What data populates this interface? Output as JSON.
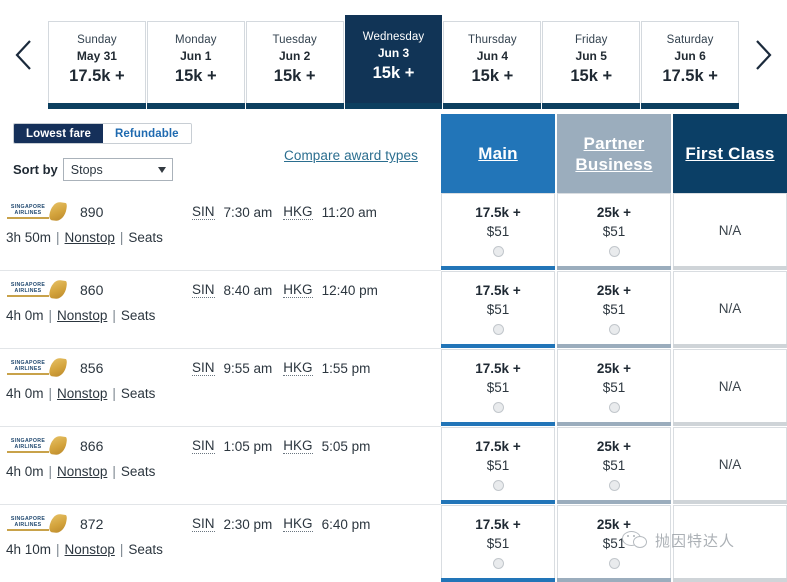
{
  "colors": {
    "selected_day_bg": "#113456",
    "day_underline": "#0d3f5f",
    "main_col": "#2275b8",
    "partner_business_col": "#9badbd",
    "first_class_col": "#0b3f66",
    "na_underline": "#cfd4d8",
    "link": "#2b6e8f"
  },
  "day_selector": {
    "prev_arrow": "chevron-left-icon",
    "next_arrow": "chevron-right-icon",
    "days": [
      {
        "dow": "Sunday",
        "date": "May 31",
        "price": "17.5k +",
        "selected": false
      },
      {
        "dow": "Monday",
        "date": "Jun 1",
        "price": "15k +",
        "selected": false
      },
      {
        "dow": "Tuesday",
        "date": "Jun 2",
        "price": "15k +",
        "selected": false
      },
      {
        "dow": "Wednesday",
        "date": "Jun 3",
        "price": "15k +",
        "selected": true
      },
      {
        "dow": "Thursday",
        "date": "Jun 4",
        "price": "15k +",
        "selected": false
      },
      {
        "dow": "Friday",
        "date": "Jun 5",
        "price": "15k +",
        "selected": false
      },
      {
        "dow": "Saturday",
        "date": "Jun 6",
        "price": "17.5k +",
        "selected": false
      }
    ]
  },
  "controls": {
    "fare_toggle": [
      {
        "label": "Lowest fare",
        "active": true
      },
      {
        "label": "Refundable",
        "active": false
      }
    ],
    "sort_label": "Sort by",
    "sort_value": "Stops",
    "sort_options": [
      "Stops"
    ],
    "compare_link": "Compare award types"
  },
  "fare_columns": [
    {
      "label": "Main",
      "color": "#2275b8"
    },
    {
      "label": "Partner\nBusiness",
      "color": "#9badbd"
    },
    {
      "label": "First Class",
      "color": "#0b3f66"
    }
  ],
  "flights": [
    {
      "airline": "SINGAPORE AIRLINES",
      "number": "890",
      "origin": "SIN",
      "depart": "7:30 am",
      "destination": "HKG",
      "arrive": "11:20 am",
      "duration": "3h 50m",
      "stops": "Nonstop",
      "seats": "Seats",
      "fares": [
        {
          "miles": "17.5k +",
          "cash": "$51",
          "available": true,
          "color": "#2275b8"
        },
        {
          "miles": "25k +",
          "cash": "$51",
          "available": true,
          "color": "#9badbd"
        },
        {
          "na": "N/A",
          "available": false,
          "color": "#cfd4d8"
        }
      ]
    },
    {
      "airline": "SINGAPORE AIRLINES",
      "number": "860",
      "origin": "SIN",
      "depart": "8:40 am",
      "destination": "HKG",
      "arrive": "12:40 pm",
      "duration": "4h 0m",
      "stops": "Nonstop",
      "seats": "Seats",
      "fares": [
        {
          "miles": "17.5k +",
          "cash": "$51",
          "available": true,
          "color": "#2275b8"
        },
        {
          "miles": "25k +",
          "cash": "$51",
          "available": true,
          "color": "#9badbd"
        },
        {
          "na": "N/A",
          "available": false,
          "color": "#cfd4d8"
        }
      ]
    },
    {
      "airline": "SINGAPORE AIRLINES",
      "number": "856",
      "origin": "SIN",
      "depart": "9:55 am",
      "destination": "HKG",
      "arrive": "1:55 pm",
      "duration": "4h 0m",
      "stops": "Nonstop",
      "seats": "Seats",
      "fares": [
        {
          "miles": "17.5k +",
          "cash": "$51",
          "available": true,
          "color": "#2275b8"
        },
        {
          "miles": "25k +",
          "cash": "$51",
          "available": true,
          "color": "#9badbd"
        },
        {
          "na": "N/A",
          "available": false,
          "color": "#cfd4d8"
        }
      ]
    },
    {
      "airline": "SINGAPORE AIRLINES",
      "number": "866",
      "origin": "SIN",
      "depart": "1:05 pm",
      "destination": "HKG",
      "arrive": "5:05 pm",
      "duration": "4h 0m",
      "stops": "Nonstop",
      "seats": "Seats",
      "fares": [
        {
          "miles": "17.5k +",
          "cash": "$51",
          "available": true,
          "color": "#2275b8"
        },
        {
          "miles": "25k +",
          "cash": "$51",
          "available": true,
          "color": "#9badbd"
        },
        {
          "na": "N/A",
          "available": false,
          "color": "#cfd4d8"
        }
      ]
    },
    {
      "airline": "SINGAPORE AIRLINES",
      "number": "872",
      "origin": "SIN",
      "depart": "2:30 pm",
      "destination": "HKG",
      "arrive": "6:40 pm",
      "duration": "4h 10m",
      "stops": "Nonstop",
      "seats": "Seats",
      "fares": [
        {
          "miles": "17.5k +",
          "cash": "$51",
          "available": true,
          "color": "#2275b8"
        },
        {
          "miles": "25k +",
          "cash": "$51",
          "available": true,
          "color": "#9badbd"
        },
        {
          "na": "",
          "available": false,
          "color": "#cfd4d8"
        }
      ]
    }
  ],
  "watermark": {
    "text": "抛因特达人",
    "icon": "wechat-icon"
  }
}
